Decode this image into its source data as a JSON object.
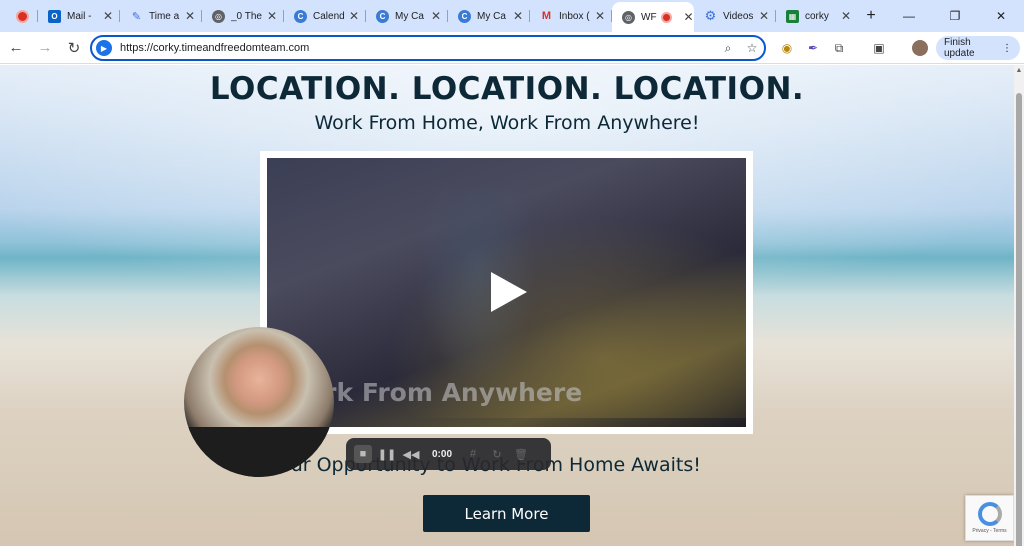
{
  "browser": {
    "tabs": [
      {
        "title": "",
        "favicon": "recording-dot-icon",
        "color": "#d93025"
      },
      {
        "title": "Mail - ",
        "favicon": "outlook-icon",
        "color": "#0a64c8"
      },
      {
        "title": "Time a",
        "favicon": "pen-icon",
        "color": "#3b6fd8"
      },
      {
        "title": "_0 The",
        "favicon": "globe-icon",
        "color": "#5f6368"
      },
      {
        "title": "Calend",
        "favicon": "c-logo-icon",
        "color": "#3a7bd5"
      },
      {
        "title": "My Ca",
        "favicon": "c-logo-icon",
        "color": "#3a7bd5"
      },
      {
        "title": "My Ca",
        "favicon": "c-logo-icon",
        "color": "#3a7bd5"
      },
      {
        "title": "Inbox (",
        "favicon": "gmail-icon",
        "color": "#d93025"
      },
      {
        "title": "WF",
        "favicon": "globe-icon",
        "color": "#5f6368",
        "active": true
      },
      {
        "title": "Videos",
        "favicon": "gear-icon",
        "color": "#3b6fd8"
      },
      {
        "title": "corky",
        "favicon": "sheet-icon",
        "color": "#188038"
      }
    ],
    "address_bar": {
      "url": "https://corky.timeandfreedomteam.com"
    },
    "update_button": "Finish update"
  },
  "page": {
    "headline": "LOCATION. LOCATION. LOCATION.",
    "subhead": "Work From Home, Work From Anywhere!",
    "video_caption": "ork From Anywhere",
    "tagline": "Your Opportunity to Work From Home Awaits!",
    "cta": "Learn More"
  },
  "recorder": {
    "time": "0:00"
  },
  "captcha": {
    "links": "Privacy - Terms"
  }
}
